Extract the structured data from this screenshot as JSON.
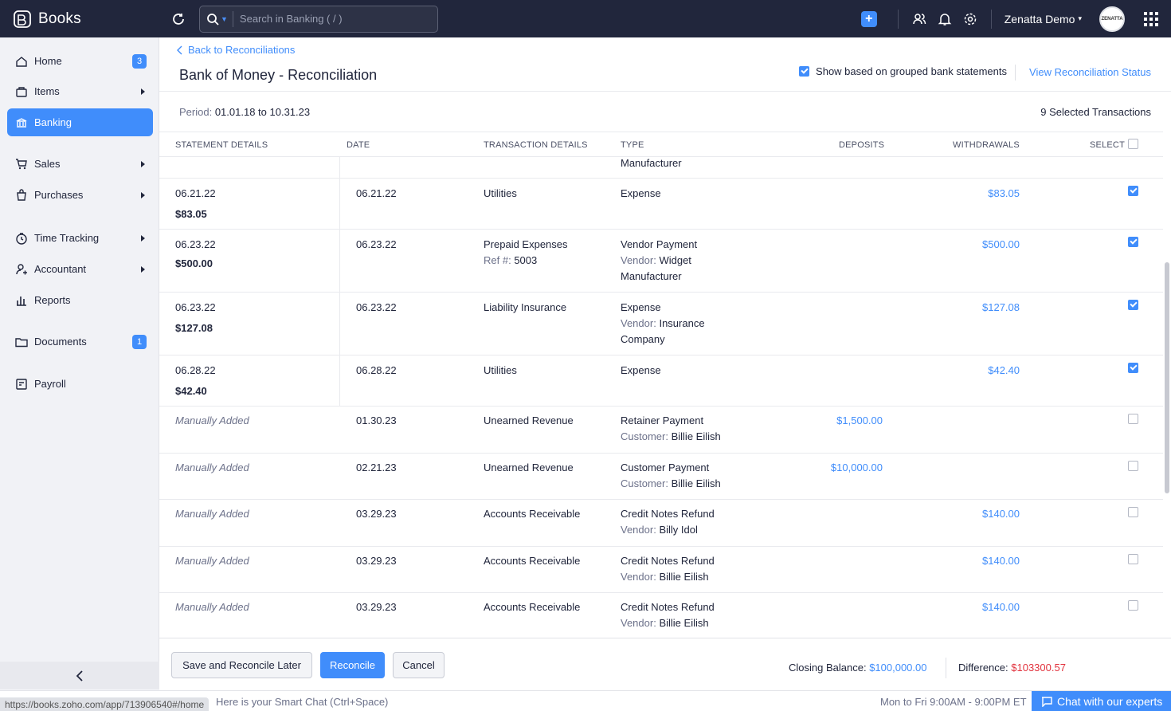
{
  "topbar": {
    "brand": "Books",
    "search_placeholder": "Search in Banking ( / )",
    "org_name": "Zenatta Demo",
    "avatar_text": "ZENATTA"
  },
  "sidebar": {
    "items": [
      {
        "label": "Home",
        "icon": "home-icon",
        "badge": "3"
      },
      {
        "label": "Items",
        "icon": "items-icon",
        "arrow": true
      },
      {
        "label": "Banking",
        "icon": "bank-icon",
        "active": true
      },
      {
        "label": "Sales",
        "icon": "cart-icon",
        "arrow": true
      },
      {
        "label": "Purchases",
        "icon": "bag-icon",
        "arrow": true
      },
      {
        "label": "Time Tracking",
        "icon": "clock-icon",
        "arrow": true
      },
      {
        "label": "Accountant",
        "icon": "accountant-icon",
        "arrow": true
      },
      {
        "label": "Reports",
        "icon": "reports-icon"
      },
      {
        "label": "Documents",
        "icon": "folder-icon",
        "badge": "1"
      },
      {
        "label": "Payroll",
        "icon": "payroll-icon"
      }
    ]
  },
  "page": {
    "back_link": "Back to Reconciliations",
    "title": "Bank of Money - Reconciliation",
    "grouped_label": "Show based on grouped bank statements",
    "grouped_checked": true,
    "status_link": "View Reconciliation Status",
    "period_label": "Period:",
    "period_value": "01.01.18 to 10.31.23",
    "selected_count": "9 Selected Transactions"
  },
  "table": {
    "headers": {
      "statement": "STATEMENT DETAILS",
      "date": "DATE",
      "transaction": "TRANSACTION DETAILS",
      "type": "TYPE",
      "deposits": "DEPOSITS",
      "withdrawals": "WITHDRAWALS",
      "select": "SELECT"
    },
    "partial_row_text": "Manufacturer",
    "rows": [
      {
        "stmt_date": "06.21.22",
        "stmt_amount": "$83.05",
        "date": "06.21.22",
        "txn": "Utilities",
        "ref": "",
        "type": "Expense",
        "party_label": "",
        "party": "",
        "party2": "",
        "deposit": "",
        "withdrawal": "$83.05",
        "checked": true
      },
      {
        "stmt_date": "06.23.22",
        "stmt_amount": "$500.00",
        "date": "06.23.22",
        "txn": "Prepaid Expenses",
        "ref_label": "Ref #:",
        "ref": "5003",
        "type": "Vendor Payment",
        "party_label": "Vendor:",
        "party": "Widget",
        "party2": "Manufacturer",
        "deposit": "",
        "withdrawal": "$500.00",
        "checked": true
      },
      {
        "stmt_date": "06.23.22",
        "stmt_amount": "$127.08",
        "date": "06.23.22",
        "txn": "Liability Insurance",
        "ref": "",
        "type": "Expense",
        "party_label": "Vendor:",
        "party": "Insurance",
        "party2": "Company",
        "deposit": "",
        "withdrawal": "$127.08",
        "checked": true
      },
      {
        "stmt_date": "06.28.22",
        "stmt_amount": "$42.40",
        "date": "06.28.22",
        "txn": "Utilities",
        "ref": "",
        "type": "Expense",
        "party_label": "",
        "party": "",
        "party2": "",
        "deposit": "",
        "withdrawal": "$42.40",
        "checked": true
      },
      {
        "manual": "Manually Added",
        "date": "01.30.23",
        "txn": "Unearned Revenue",
        "type": "Retainer Payment",
        "party_label": "Customer:",
        "party": "Billie Eilish",
        "deposit": "$1,500.00",
        "withdrawal": "",
        "checked": false
      },
      {
        "manual": "Manually Added",
        "date": "02.21.23",
        "txn": "Unearned Revenue",
        "type": "Customer Payment",
        "party_label": "Customer:",
        "party": "Billie Eilish",
        "deposit": "$10,000.00",
        "withdrawal": "",
        "checked": false
      },
      {
        "manual": "Manually Added",
        "date": "03.29.23",
        "txn": "Accounts Receivable",
        "type": "Credit Notes Refund",
        "party_label": "Vendor:",
        "party": "Billy Idol",
        "deposit": "",
        "withdrawal": "$140.00",
        "checked": false
      },
      {
        "manual": "Manually Added",
        "date": "03.29.23",
        "txn": "Accounts Receivable",
        "type": "Credit Notes Refund",
        "party_label": "Vendor:",
        "party": "Billie Eilish",
        "deposit": "",
        "withdrawal": "$140.00",
        "checked": false
      },
      {
        "manual": "Manually Added",
        "date": "03.29.23",
        "txn": "Accounts Receivable",
        "type": "Credit Notes Refund",
        "party_label": "Vendor:",
        "party": "Billie Eilish",
        "deposit": "",
        "withdrawal": "$140.00",
        "checked": false
      }
    ]
  },
  "footer": {
    "save_later": "Save and Reconcile Later",
    "reconcile": "Reconcile",
    "cancel": "Cancel",
    "closing_label": "Closing Balance:",
    "closing_value": "$100,000.00",
    "difference_label": "Difference:",
    "difference_value": "$103300.57"
  },
  "bottombar": {
    "url": "https://books.zoho.com/app/713906540#/home",
    "smartchat": "Here is your Smart Chat (Ctrl+Space)",
    "hours": "Mon to Fri 9:00AM - 9:00PM ET",
    "chat_button": "Chat with our experts"
  },
  "colors": {
    "accent": "#408dfb",
    "topbar": "#21263c",
    "negative": "#e2343f"
  }
}
